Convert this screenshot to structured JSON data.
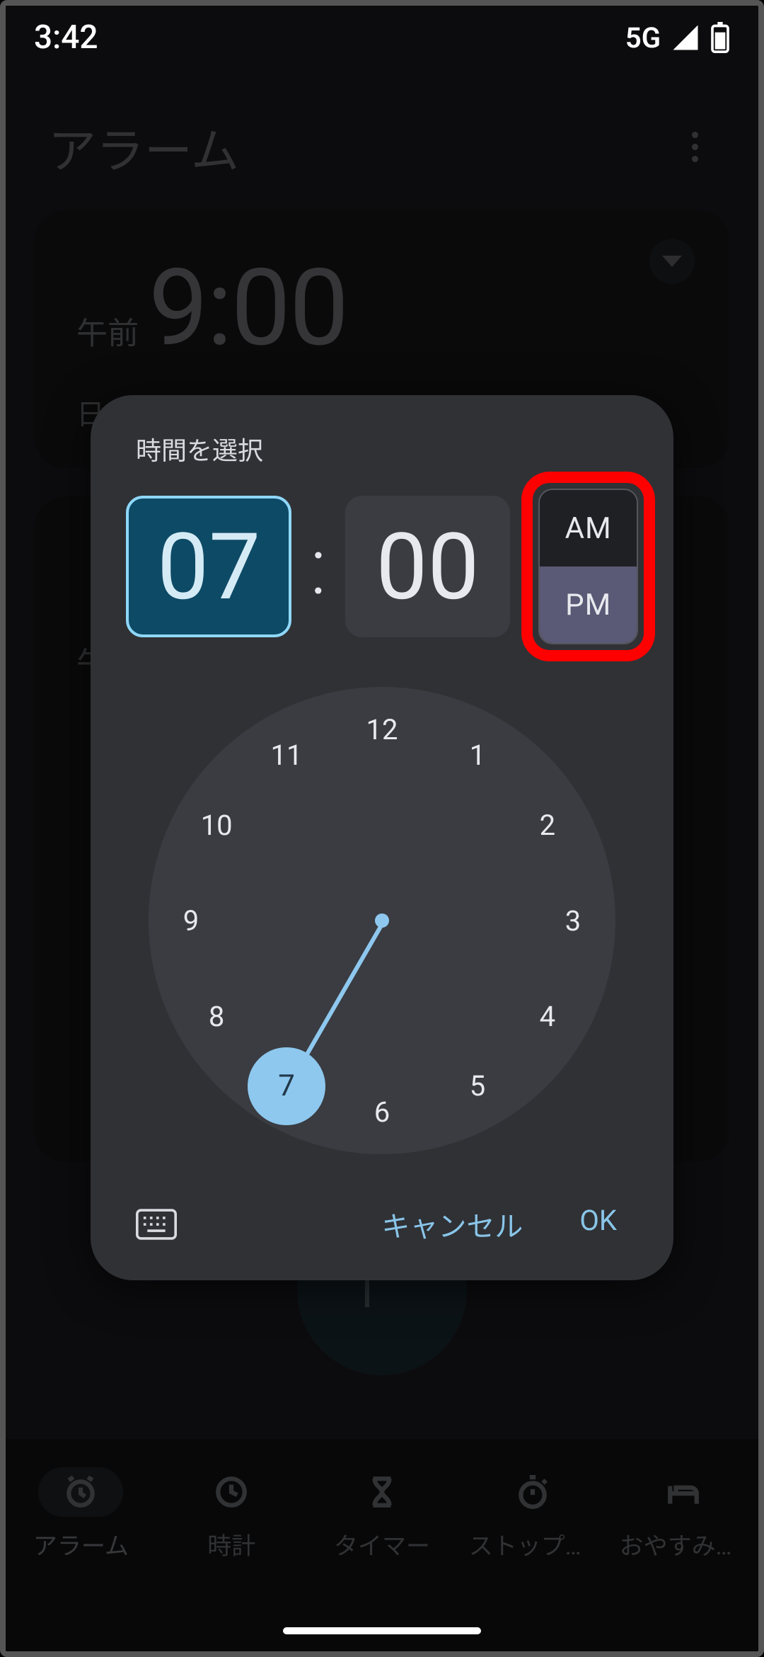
{
  "status_bar": {
    "time": "3:42",
    "signal": "5G"
  },
  "app_bar": {
    "title": "アラーム"
  },
  "alarm_card": {
    "ampm": "午前",
    "time": "9:00",
    "sub": "日"
  },
  "bg_alarm2_prefix": "午",
  "dialog": {
    "title": "時間を選択",
    "hour": "07",
    "minute": "00",
    "colon": ":",
    "am": "AM",
    "pm": "PM",
    "selected_meridiem": "PM",
    "selected_hour": 7,
    "cancel": "キャンセル",
    "ok": "OK"
  },
  "clock_numbers": [
    "12",
    "1",
    "2",
    "3",
    "4",
    "5",
    "6",
    "7",
    "8",
    "9",
    "10",
    "11"
  ],
  "nav": {
    "items": [
      {
        "label": "アラーム"
      },
      {
        "label": "時計"
      },
      {
        "label": "タイマー"
      },
      {
        "label": "ストップウ..."
      },
      {
        "label": "おやすみ時..."
      }
    ]
  },
  "fab_label": "+"
}
